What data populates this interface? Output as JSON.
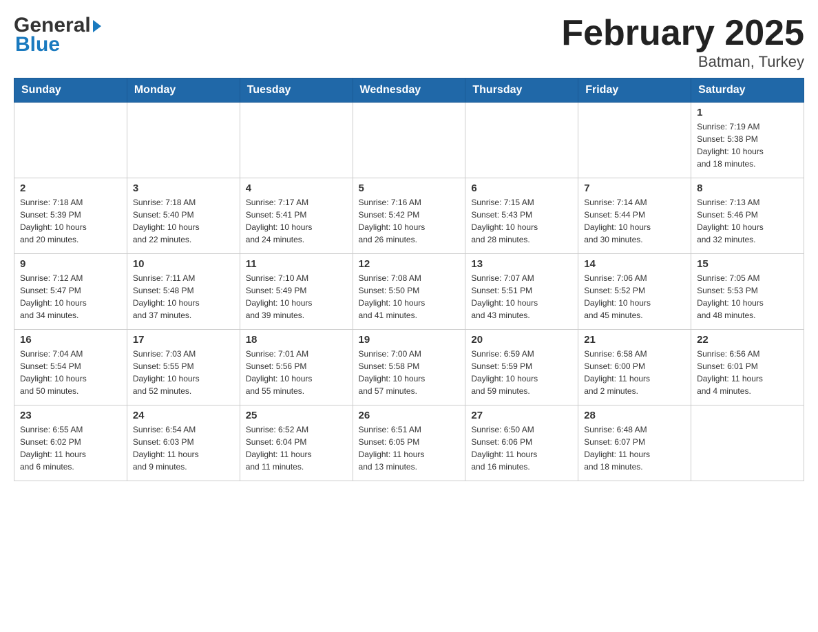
{
  "header": {
    "title": "February 2025",
    "subtitle": "Batman, Turkey"
  },
  "logo": {
    "line1": "General",
    "line2": "Blue"
  },
  "days_of_week": [
    "Sunday",
    "Monday",
    "Tuesday",
    "Wednesday",
    "Thursday",
    "Friday",
    "Saturday"
  ],
  "weeks": [
    [
      {
        "day": "",
        "info": ""
      },
      {
        "day": "",
        "info": ""
      },
      {
        "day": "",
        "info": ""
      },
      {
        "day": "",
        "info": ""
      },
      {
        "day": "",
        "info": ""
      },
      {
        "day": "",
        "info": ""
      },
      {
        "day": "1",
        "info": "Sunrise: 7:19 AM\nSunset: 5:38 PM\nDaylight: 10 hours\nand 18 minutes."
      }
    ],
    [
      {
        "day": "2",
        "info": "Sunrise: 7:18 AM\nSunset: 5:39 PM\nDaylight: 10 hours\nand 20 minutes."
      },
      {
        "day": "3",
        "info": "Sunrise: 7:18 AM\nSunset: 5:40 PM\nDaylight: 10 hours\nand 22 minutes."
      },
      {
        "day": "4",
        "info": "Sunrise: 7:17 AM\nSunset: 5:41 PM\nDaylight: 10 hours\nand 24 minutes."
      },
      {
        "day": "5",
        "info": "Sunrise: 7:16 AM\nSunset: 5:42 PM\nDaylight: 10 hours\nand 26 minutes."
      },
      {
        "day": "6",
        "info": "Sunrise: 7:15 AM\nSunset: 5:43 PM\nDaylight: 10 hours\nand 28 minutes."
      },
      {
        "day": "7",
        "info": "Sunrise: 7:14 AM\nSunset: 5:44 PM\nDaylight: 10 hours\nand 30 minutes."
      },
      {
        "day": "8",
        "info": "Sunrise: 7:13 AM\nSunset: 5:46 PM\nDaylight: 10 hours\nand 32 minutes."
      }
    ],
    [
      {
        "day": "9",
        "info": "Sunrise: 7:12 AM\nSunset: 5:47 PM\nDaylight: 10 hours\nand 34 minutes."
      },
      {
        "day": "10",
        "info": "Sunrise: 7:11 AM\nSunset: 5:48 PM\nDaylight: 10 hours\nand 37 minutes."
      },
      {
        "day": "11",
        "info": "Sunrise: 7:10 AM\nSunset: 5:49 PM\nDaylight: 10 hours\nand 39 minutes."
      },
      {
        "day": "12",
        "info": "Sunrise: 7:08 AM\nSunset: 5:50 PM\nDaylight: 10 hours\nand 41 minutes."
      },
      {
        "day": "13",
        "info": "Sunrise: 7:07 AM\nSunset: 5:51 PM\nDaylight: 10 hours\nand 43 minutes."
      },
      {
        "day": "14",
        "info": "Sunrise: 7:06 AM\nSunset: 5:52 PM\nDaylight: 10 hours\nand 45 minutes."
      },
      {
        "day": "15",
        "info": "Sunrise: 7:05 AM\nSunset: 5:53 PM\nDaylight: 10 hours\nand 48 minutes."
      }
    ],
    [
      {
        "day": "16",
        "info": "Sunrise: 7:04 AM\nSunset: 5:54 PM\nDaylight: 10 hours\nand 50 minutes."
      },
      {
        "day": "17",
        "info": "Sunrise: 7:03 AM\nSunset: 5:55 PM\nDaylight: 10 hours\nand 52 minutes."
      },
      {
        "day": "18",
        "info": "Sunrise: 7:01 AM\nSunset: 5:56 PM\nDaylight: 10 hours\nand 55 minutes."
      },
      {
        "day": "19",
        "info": "Sunrise: 7:00 AM\nSunset: 5:58 PM\nDaylight: 10 hours\nand 57 minutes."
      },
      {
        "day": "20",
        "info": "Sunrise: 6:59 AM\nSunset: 5:59 PM\nDaylight: 10 hours\nand 59 minutes."
      },
      {
        "day": "21",
        "info": "Sunrise: 6:58 AM\nSunset: 6:00 PM\nDaylight: 11 hours\nand 2 minutes."
      },
      {
        "day": "22",
        "info": "Sunrise: 6:56 AM\nSunset: 6:01 PM\nDaylight: 11 hours\nand 4 minutes."
      }
    ],
    [
      {
        "day": "23",
        "info": "Sunrise: 6:55 AM\nSunset: 6:02 PM\nDaylight: 11 hours\nand 6 minutes."
      },
      {
        "day": "24",
        "info": "Sunrise: 6:54 AM\nSunset: 6:03 PM\nDaylight: 11 hours\nand 9 minutes."
      },
      {
        "day": "25",
        "info": "Sunrise: 6:52 AM\nSunset: 6:04 PM\nDaylight: 11 hours\nand 11 minutes."
      },
      {
        "day": "26",
        "info": "Sunrise: 6:51 AM\nSunset: 6:05 PM\nDaylight: 11 hours\nand 13 minutes."
      },
      {
        "day": "27",
        "info": "Sunrise: 6:50 AM\nSunset: 6:06 PM\nDaylight: 11 hours\nand 16 minutes."
      },
      {
        "day": "28",
        "info": "Sunrise: 6:48 AM\nSunset: 6:07 PM\nDaylight: 11 hours\nand 18 minutes."
      },
      {
        "day": "",
        "info": ""
      }
    ]
  ]
}
